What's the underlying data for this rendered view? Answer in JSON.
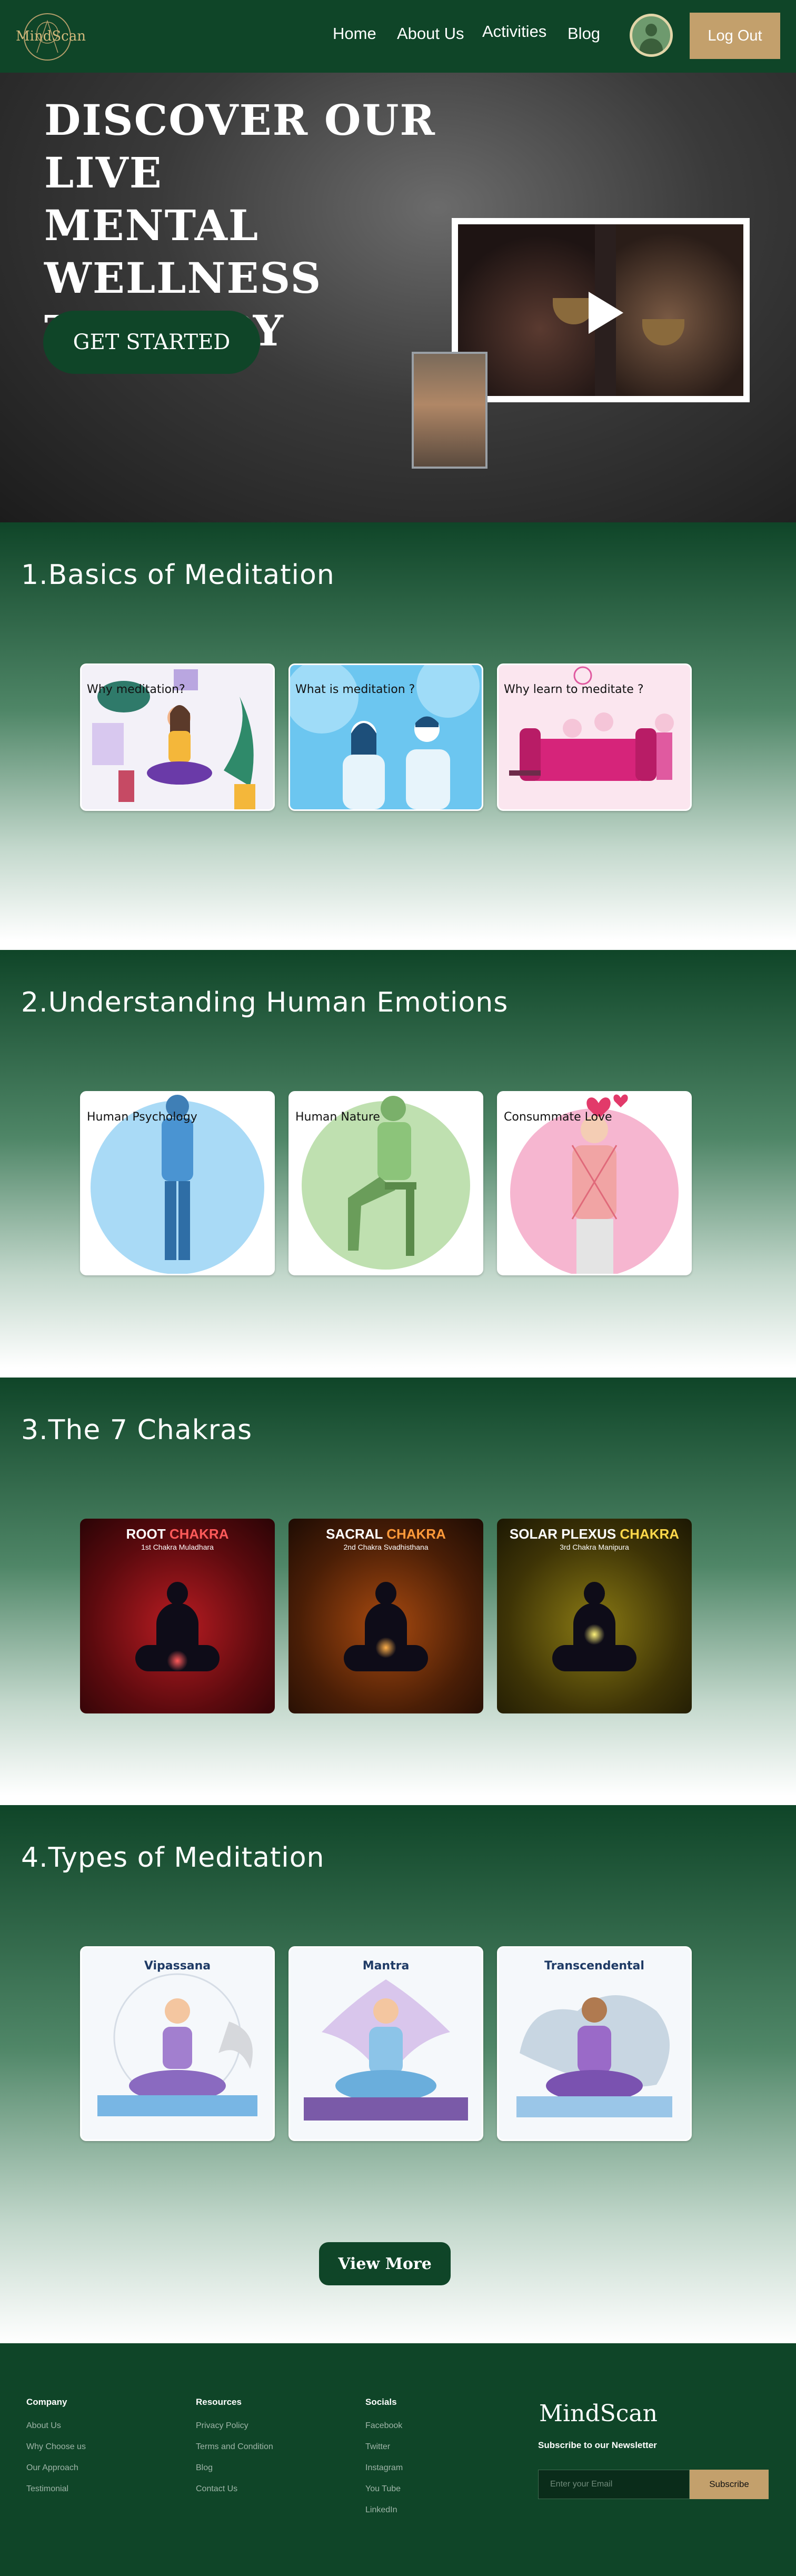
{
  "nav": {
    "logo_text": "MindScan",
    "links": [
      "Home",
      "About Us",
      "Activities",
      "Blog"
    ],
    "logout": "Log Out"
  },
  "hero": {
    "title_lines": [
      "DISCOVER OUR LIVE",
      "MENTAL WELLNESS",
      "THERAPY"
    ],
    "cta": "GET STARTED"
  },
  "sections": [
    {
      "title": "1.Basics of Meditation",
      "cards": [
        "Why meditation?",
        "What is meditation ?",
        "Why learn to meditate ?"
      ]
    },
    {
      "title": "2.Understanding Human Emotions",
      "cards": [
        "Human Psychology",
        "Human Nature",
        "Consummate Love"
      ]
    },
    {
      "title": "3.The 7 Chakras",
      "cards": [
        {
          "title": "ROOT",
          "accent": "CHAKRA",
          "subtitle": "1st Chakra Muladhara"
        },
        {
          "title": "SACRAL",
          "accent": "CHAKRA",
          "subtitle": "2nd Chakra Svadhisthana"
        },
        {
          "title": "SOLAR PLEXUS",
          "accent": "CHAKRA",
          "subtitle": "3rd Chakra Manipura"
        }
      ]
    },
    {
      "title": "4.Types of Meditation",
      "cards": [
        "Vipassana",
        "Mantra",
        "Transcendental"
      ]
    }
  ],
  "view_more": "View More",
  "footer": {
    "company": {
      "heading": "Company",
      "links": [
        "About Us",
        "Why Choose us",
        "Our Approach",
        "Testimonial"
      ]
    },
    "resources": {
      "heading": "Resources",
      "links": [
        "Privacy Policy",
        "Terms and Condition",
        "Blog",
        "Contact Us"
      ]
    },
    "socials": {
      "heading": "Socials",
      "links": [
        "Facebook",
        "Twitter",
        "Instagram",
        "You Tube",
        "LinkedIn"
      ]
    },
    "brand": "MindScan",
    "newsletter": "Subscribe to our Newsletter",
    "email_placeholder": "Enter your Email",
    "subscribe": "Subscribe"
  },
  "colors": {
    "primary": "#0f4528",
    "accent": "#c3a06c"
  }
}
